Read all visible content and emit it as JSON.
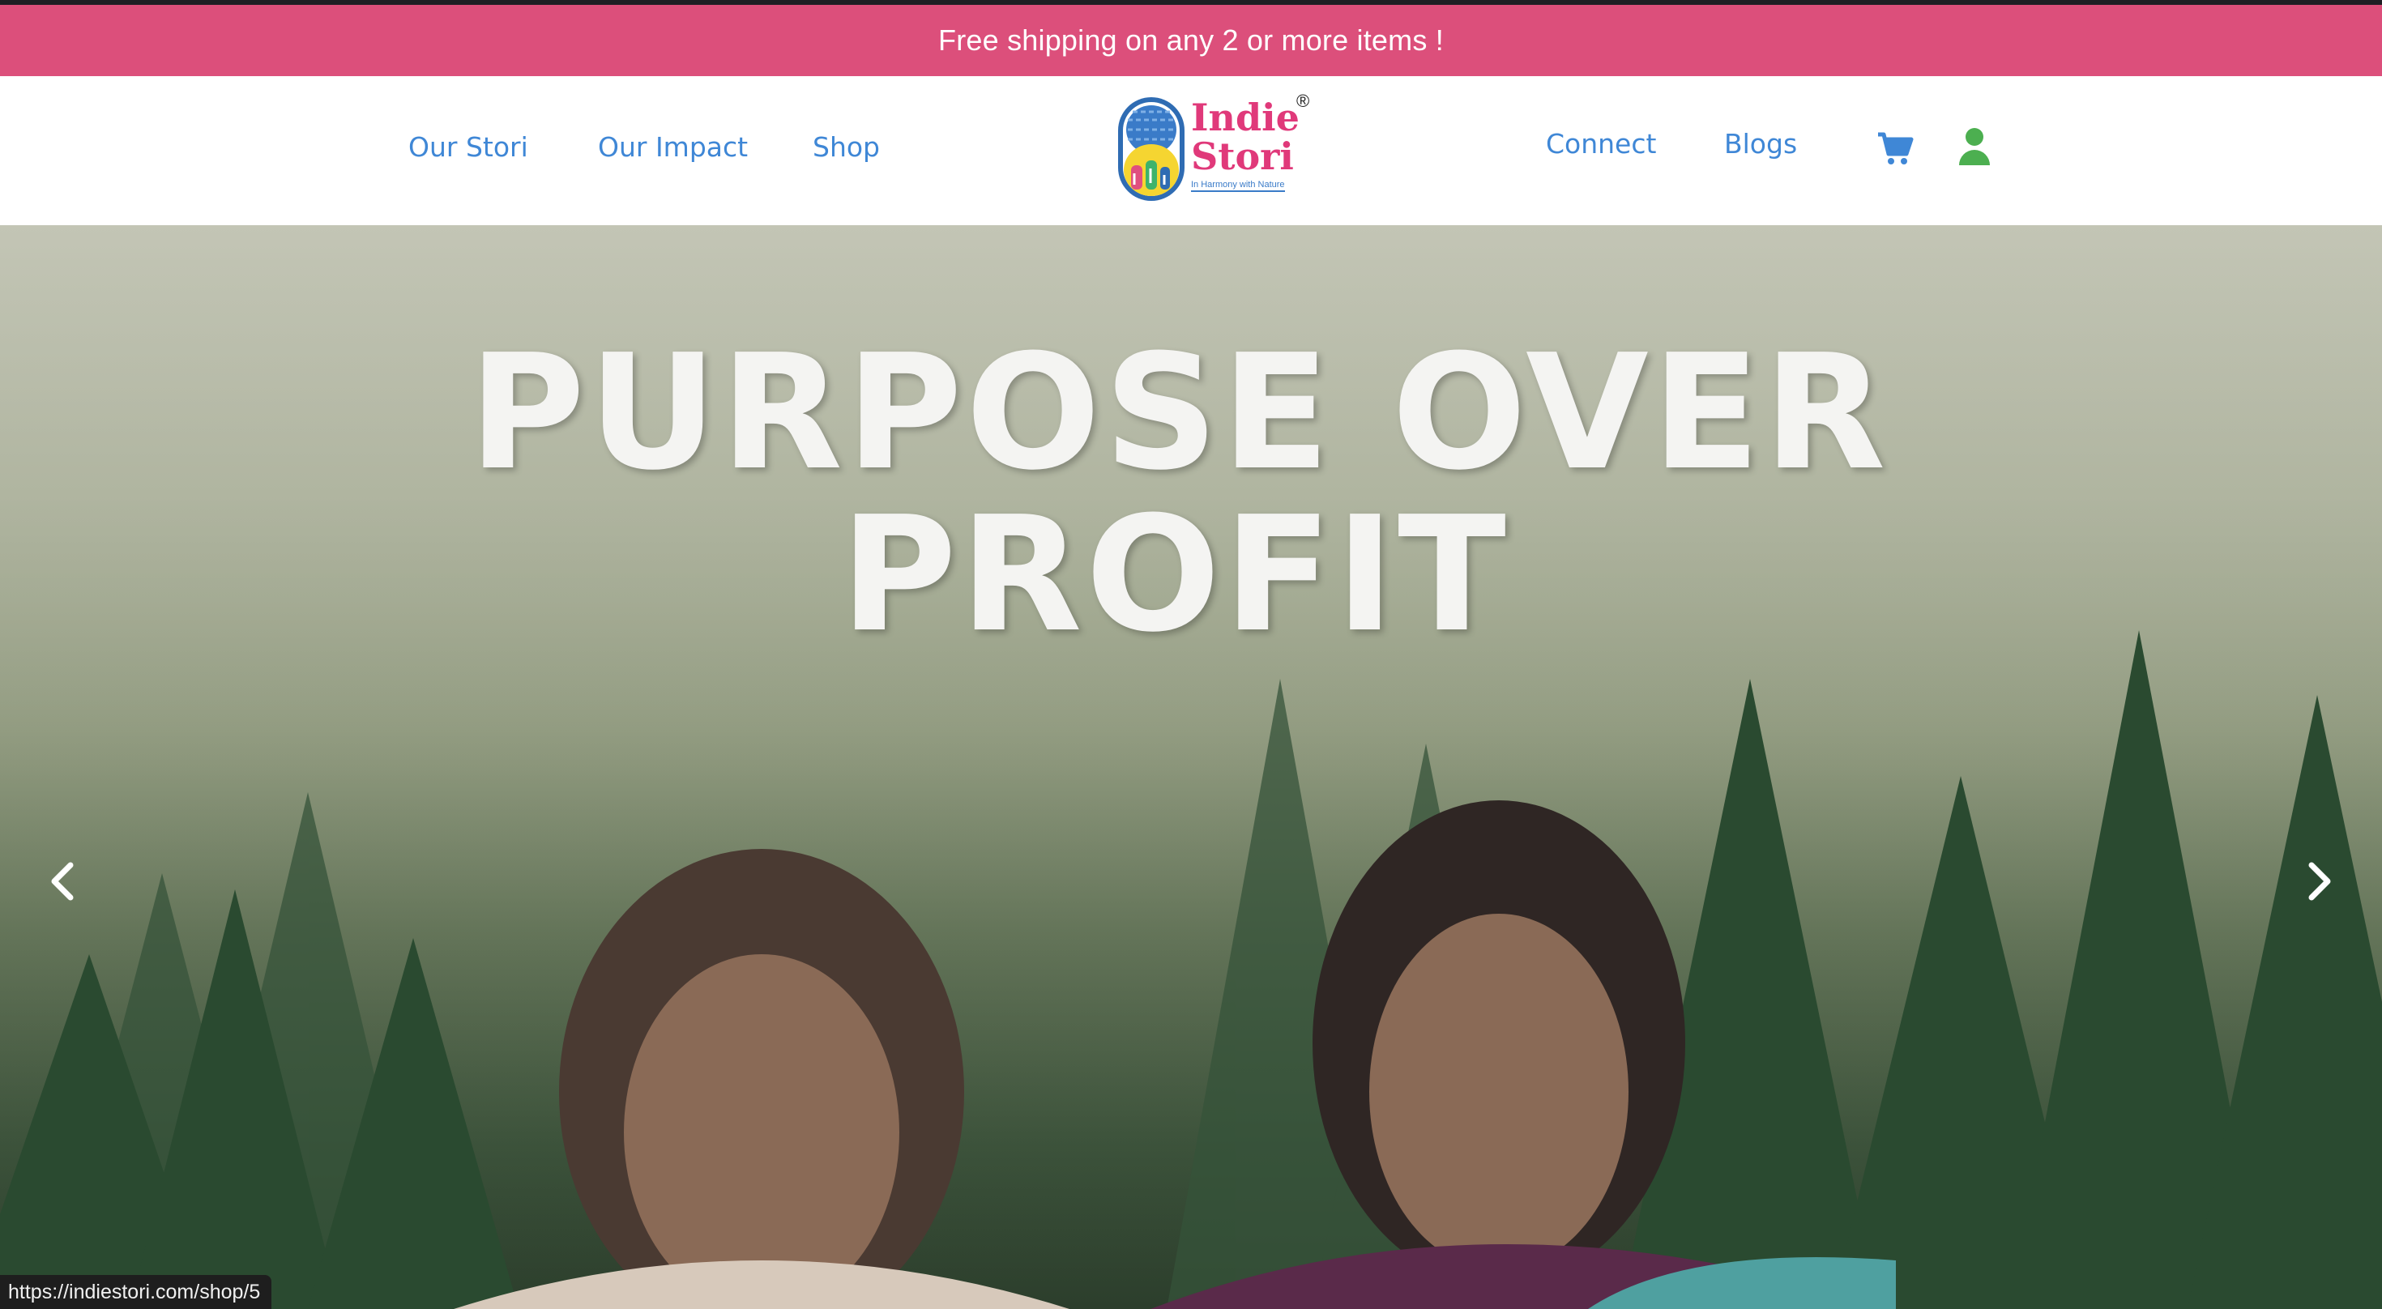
{
  "promo": {
    "text": "Free shipping on any 2 or more items !"
  },
  "nav": {
    "left": [
      "Our Stori",
      "Our Impact",
      "Shop"
    ],
    "right": [
      "Connect",
      "Blogs"
    ]
  },
  "logo": {
    "line1": "Indie",
    "line2": "Stori",
    "mark": "®",
    "tagline": "In Harmony with Nature"
  },
  "icons": {
    "cart": "cart-icon",
    "account": "user-icon"
  },
  "hero": {
    "headline_line1": "PURPOSE OVER",
    "headline_line2": "PROFIT",
    "prev_icon": "chevron-left-icon",
    "next_icon": "chevron-right-icon"
  },
  "status_bar": {
    "url": "https://indiestori.com/shop/5"
  },
  "colors": {
    "promo": "#dc4f7b",
    "link": "#3f87d6",
    "logo_pink": "#e0397a",
    "account_icon": "#4caf50"
  }
}
